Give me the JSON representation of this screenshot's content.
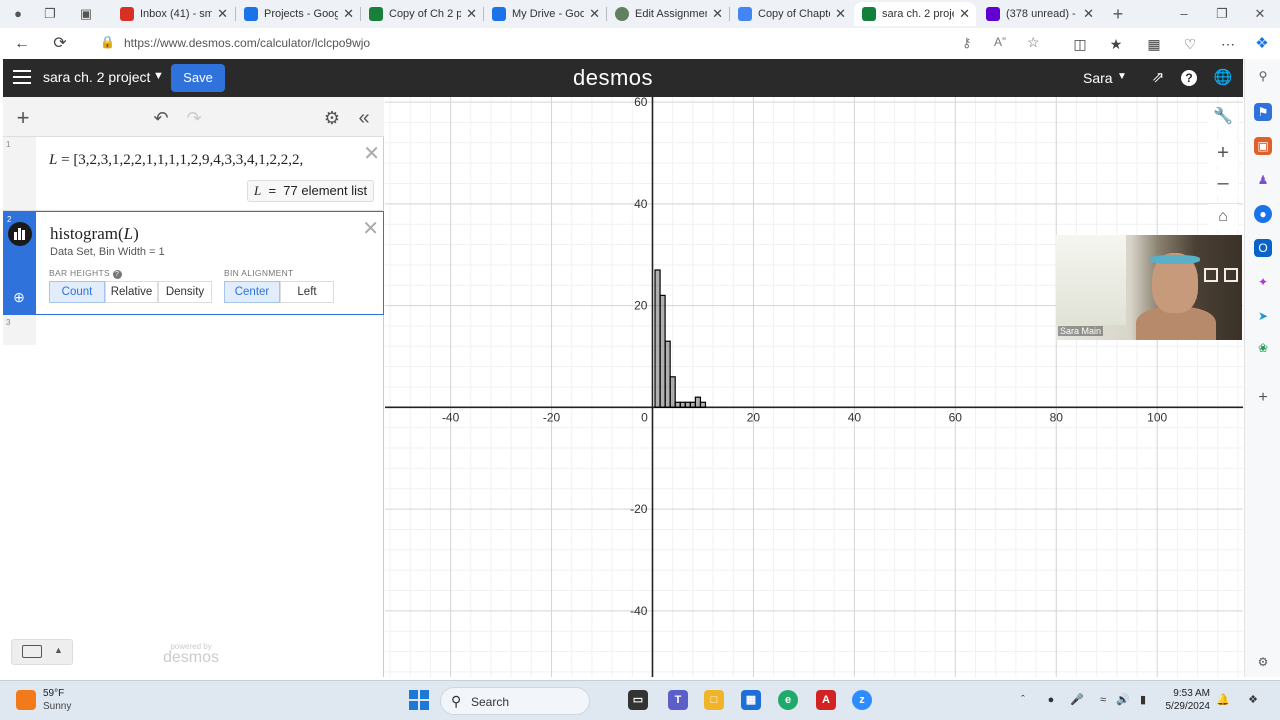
{
  "browser": {
    "tabs": [
      {
        "label": "Inbox (41) - smi",
        "favicon_color": "#d93025",
        "icon": "gmail-icon"
      },
      {
        "label": "Projects - Goog",
        "favicon_color": "#1a73e8",
        "icon": "google-drive-icon"
      },
      {
        "label": "Copy of Ch 2 pr",
        "favicon_color": "#188038",
        "icon": "google-sheets-icon"
      },
      {
        "label": "My Drive - Goo",
        "favicon_color": "#1a73e8",
        "icon": "google-drive-icon"
      },
      {
        "label": "Edit Assignmen",
        "favicon_color": "#5f7f5f",
        "icon": "assignment-icon"
      },
      {
        "label": "Copy of Chapte",
        "favicon_color": "#4285f4",
        "icon": "google-docs-icon"
      },
      {
        "label": "sara ch. 2 proje",
        "favicon_color": "#127f3b",
        "icon": "desmos-icon"
      },
      {
        "label": "(378 unread) - ",
        "favicon_color": "#6001d2",
        "icon": "yahoo-mail-icon"
      }
    ],
    "active_tab_index": 6,
    "url": "https://www.desmos.com/calculator/lclcpo9wjo"
  },
  "desmos": {
    "graph_title": "sara ch. 2 project",
    "save_label": "Save",
    "logo": "desmos",
    "user_name": "Sara",
    "expressions": {
      "e1_number": "1",
      "e1_var": "L",
      "e1_list": "[3,2,3,1,2,2,1,1,1,1,2,9,4,3,3,4,1,2,2,2,",
      "e1_result_var": "L",
      "e1_result_text": "77 element list",
      "e2_number": "2",
      "e2_func": "histogram",
      "e2_arg": "L",
      "e2_desc": "Data Set, Bin Width = 1",
      "bar_heights_label": "BAR HEIGHTS",
      "bar_heights_options": [
        "Count",
        "Relative",
        "Density"
      ],
      "bar_heights_selected": "Count",
      "bin_alignment_label": "BIN ALIGNMENT",
      "bin_alignment_options": [
        "Center",
        "Left"
      ],
      "bin_alignment_selected": "Center",
      "e3_number": "3"
    },
    "powered_by_small": "powered by",
    "powered_by_logo": "desmos"
  },
  "chart_data": {
    "type": "bar",
    "x_tick_labels": [
      "-40",
      "-20",
      "0",
      "20",
      "40",
      "60",
      "80",
      "100"
    ],
    "y_tick_labels": [
      "60",
      "40",
      "20",
      "-20",
      "-40"
    ],
    "xlim": [
      -53,
      117
    ],
    "ylim": [
      -53,
      61
    ],
    "grid": true,
    "bin_width": 1,
    "bins": [
      1,
      2,
      3,
      4,
      5,
      6,
      7,
      8,
      9,
      10
    ],
    "counts": [
      27,
      22,
      13,
      6,
      1,
      1,
      1,
      1,
      2,
      1
    ]
  },
  "webcam": {
    "name": "Sara Main"
  },
  "taskbar": {
    "weather_temp": "59°F",
    "weather_desc": "Sunny",
    "search_text": "Search",
    "time": "9:53 AM",
    "date": "5/29/2024"
  }
}
